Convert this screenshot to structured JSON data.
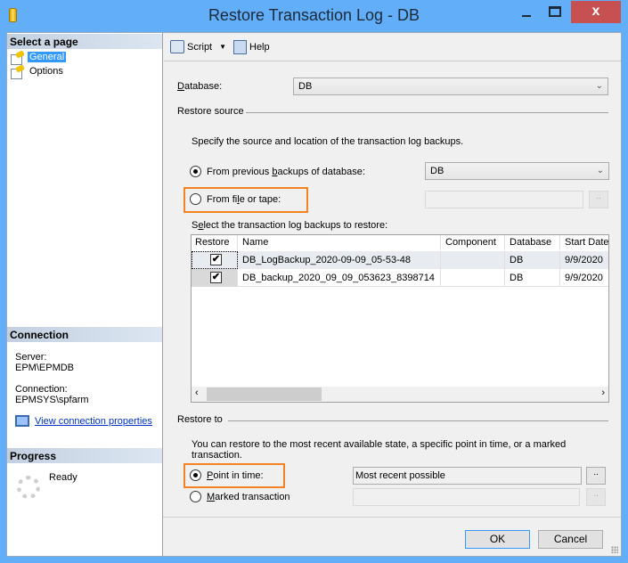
{
  "window": {
    "title": "Restore Transaction Log  -  DB",
    "close_glyph": "x"
  },
  "sidebar": {
    "select_page_header": "Select a page",
    "pages": [
      {
        "label": "General",
        "selected": true
      },
      {
        "label": "Options",
        "selected": false
      }
    ],
    "connection_header": "Connection",
    "server_label": "Server:",
    "server_value": "EPM\\EPMDB",
    "connection_label": "Connection:",
    "connection_value": "EPMSYS\\spfarm",
    "view_connection_link": "View connection properties",
    "progress_header": "Progress",
    "progress_status": "Ready"
  },
  "toolbar": {
    "script_label": "Script",
    "help_label": "Help"
  },
  "general": {
    "database_label_pre": "",
    "database_label_u": "D",
    "database_label_post": "atabase:",
    "database_value": "DB",
    "restore_source_heading": "Restore source",
    "source_desc": "Specify the source and location of the transaction log backups.",
    "from_previous_pre": "From previous ",
    "from_previous_u": "b",
    "from_previous_post": "ackups of database:",
    "from_previous_selected": true,
    "from_previous_value": "DB",
    "from_file_pre": "From fi",
    "from_file_u": "l",
    "from_file_post": "e or tape:",
    "from_file_selected": false,
    "from_file_value": "",
    "browse_label": "..",
    "select_backups_pre": "S",
    "select_backups_u": "e",
    "select_backups_post": "lect the transaction log backups to restore:",
    "grid": {
      "columns": [
        "Restore",
        "Name",
        "Component",
        "Database",
        "Start Date"
      ],
      "rows": [
        {
          "restore": true,
          "name": "DB_LogBackup_2020-09-09_05-53-48",
          "component": "",
          "database": "DB",
          "start_date": "9/9/2020"
        },
        {
          "restore": true,
          "name": "DB_backup_2020_09_09_053623_8398714",
          "component": "",
          "database": "DB",
          "start_date": "9/9/2020"
        }
      ],
      "check_glyph": "✔"
    },
    "restore_to_heading": "Restore to",
    "restore_to_desc": "You can restore to the most recent available state, a specific point in time, or a marked transaction.",
    "point_in_time_u": "P",
    "point_in_time_post": "oint in time:",
    "point_in_time_selected": true,
    "point_in_time_value": "Most recent possible",
    "marked_u": "M",
    "marked_post": "arked transaction",
    "marked_selected": false,
    "marked_value": ""
  },
  "footer": {
    "ok_label": "OK",
    "cancel_label": "Cancel"
  },
  "colors": {
    "highlight": "#f58220",
    "title_bar": "#62aef8",
    "close": "#c75050",
    "selection": "#3399ff"
  }
}
